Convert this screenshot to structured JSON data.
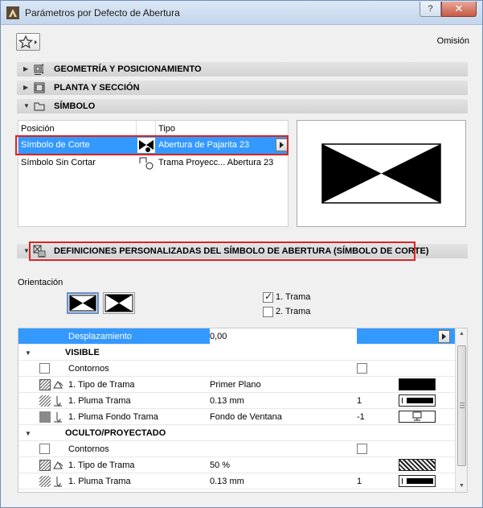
{
  "window": {
    "title": "Parámetros por Defecto de Abertura",
    "help_label": "?",
    "close_label": "✕"
  },
  "toolbar": {
    "omision_label": "Omisión"
  },
  "panels": {
    "geometry": "GEOMETRÍA Y POSICIONAMIENTO",
    "plan_section": "PLANTA Y SECCIÓN",
    "symbol": "SÍMBOLO",
    "custom": "DEFINICIONES PERSONALIZADAS DEL SÍMBOLO DE ABERTURA (SÍMBOLO DE CORTE)"
  },
  "symbol_list": {
    "headers": {
      "position": "Posición",
      "type": "Tipo"
    },
    "rows": [
      {
        "position": "Símbolo de Corte",
        "type": "Abertura de Pajarita 23"
      },
      {
        "position": "Símbolo Sin Cortar",
        "type": "Trama Proyecc... Abertura 23"
      }
    ]
  },
  "orientation": {
    "label": "Orientación",
    "trama1": "1. Trama",
    "trama2": "2. Trama",
    "trama1_checked": true,
    "trama2_checked": false
  },
  "grid": {
    "head": {
      "label": "Desplazamiento",
      "value": "0,00"
    },
    "visible_group": "VISIBLE",
    "hidden_group": "OCULTO/PROYECTADO",
    "rows": [
      {
        "label": "Contornos",
        "value": "",
        "num": ""
      },
      {
        "label": "1. Tipo de Trama",
        "value": "Primer Plano",
        "num": ""
      },
      {
        "label": "1. Pluma Trama",
        "value": "0.13 mm",
        "num": "1"
      },
      {
        "label": "1. Pluma Fondo Trama",
        "value": "Fondo de Ventana",
        "num": "-1"
      }
    ],
    "hidden_rows": [
      {
        "label": "Contornos",
        "value": "",
        "num": ""
      },
      {
        "label": "1. Tipo de Trama",
        "value": "50 %",
        "num": ""
      },
      {
        "label": "1. Pluma Trama",
        "value": "0.13 mm",
        "num": "1"
      }
    ]
  },
  "colors": {
    "selection": "#3399ff",
    "highlight": "#e0201e"
  }
}
